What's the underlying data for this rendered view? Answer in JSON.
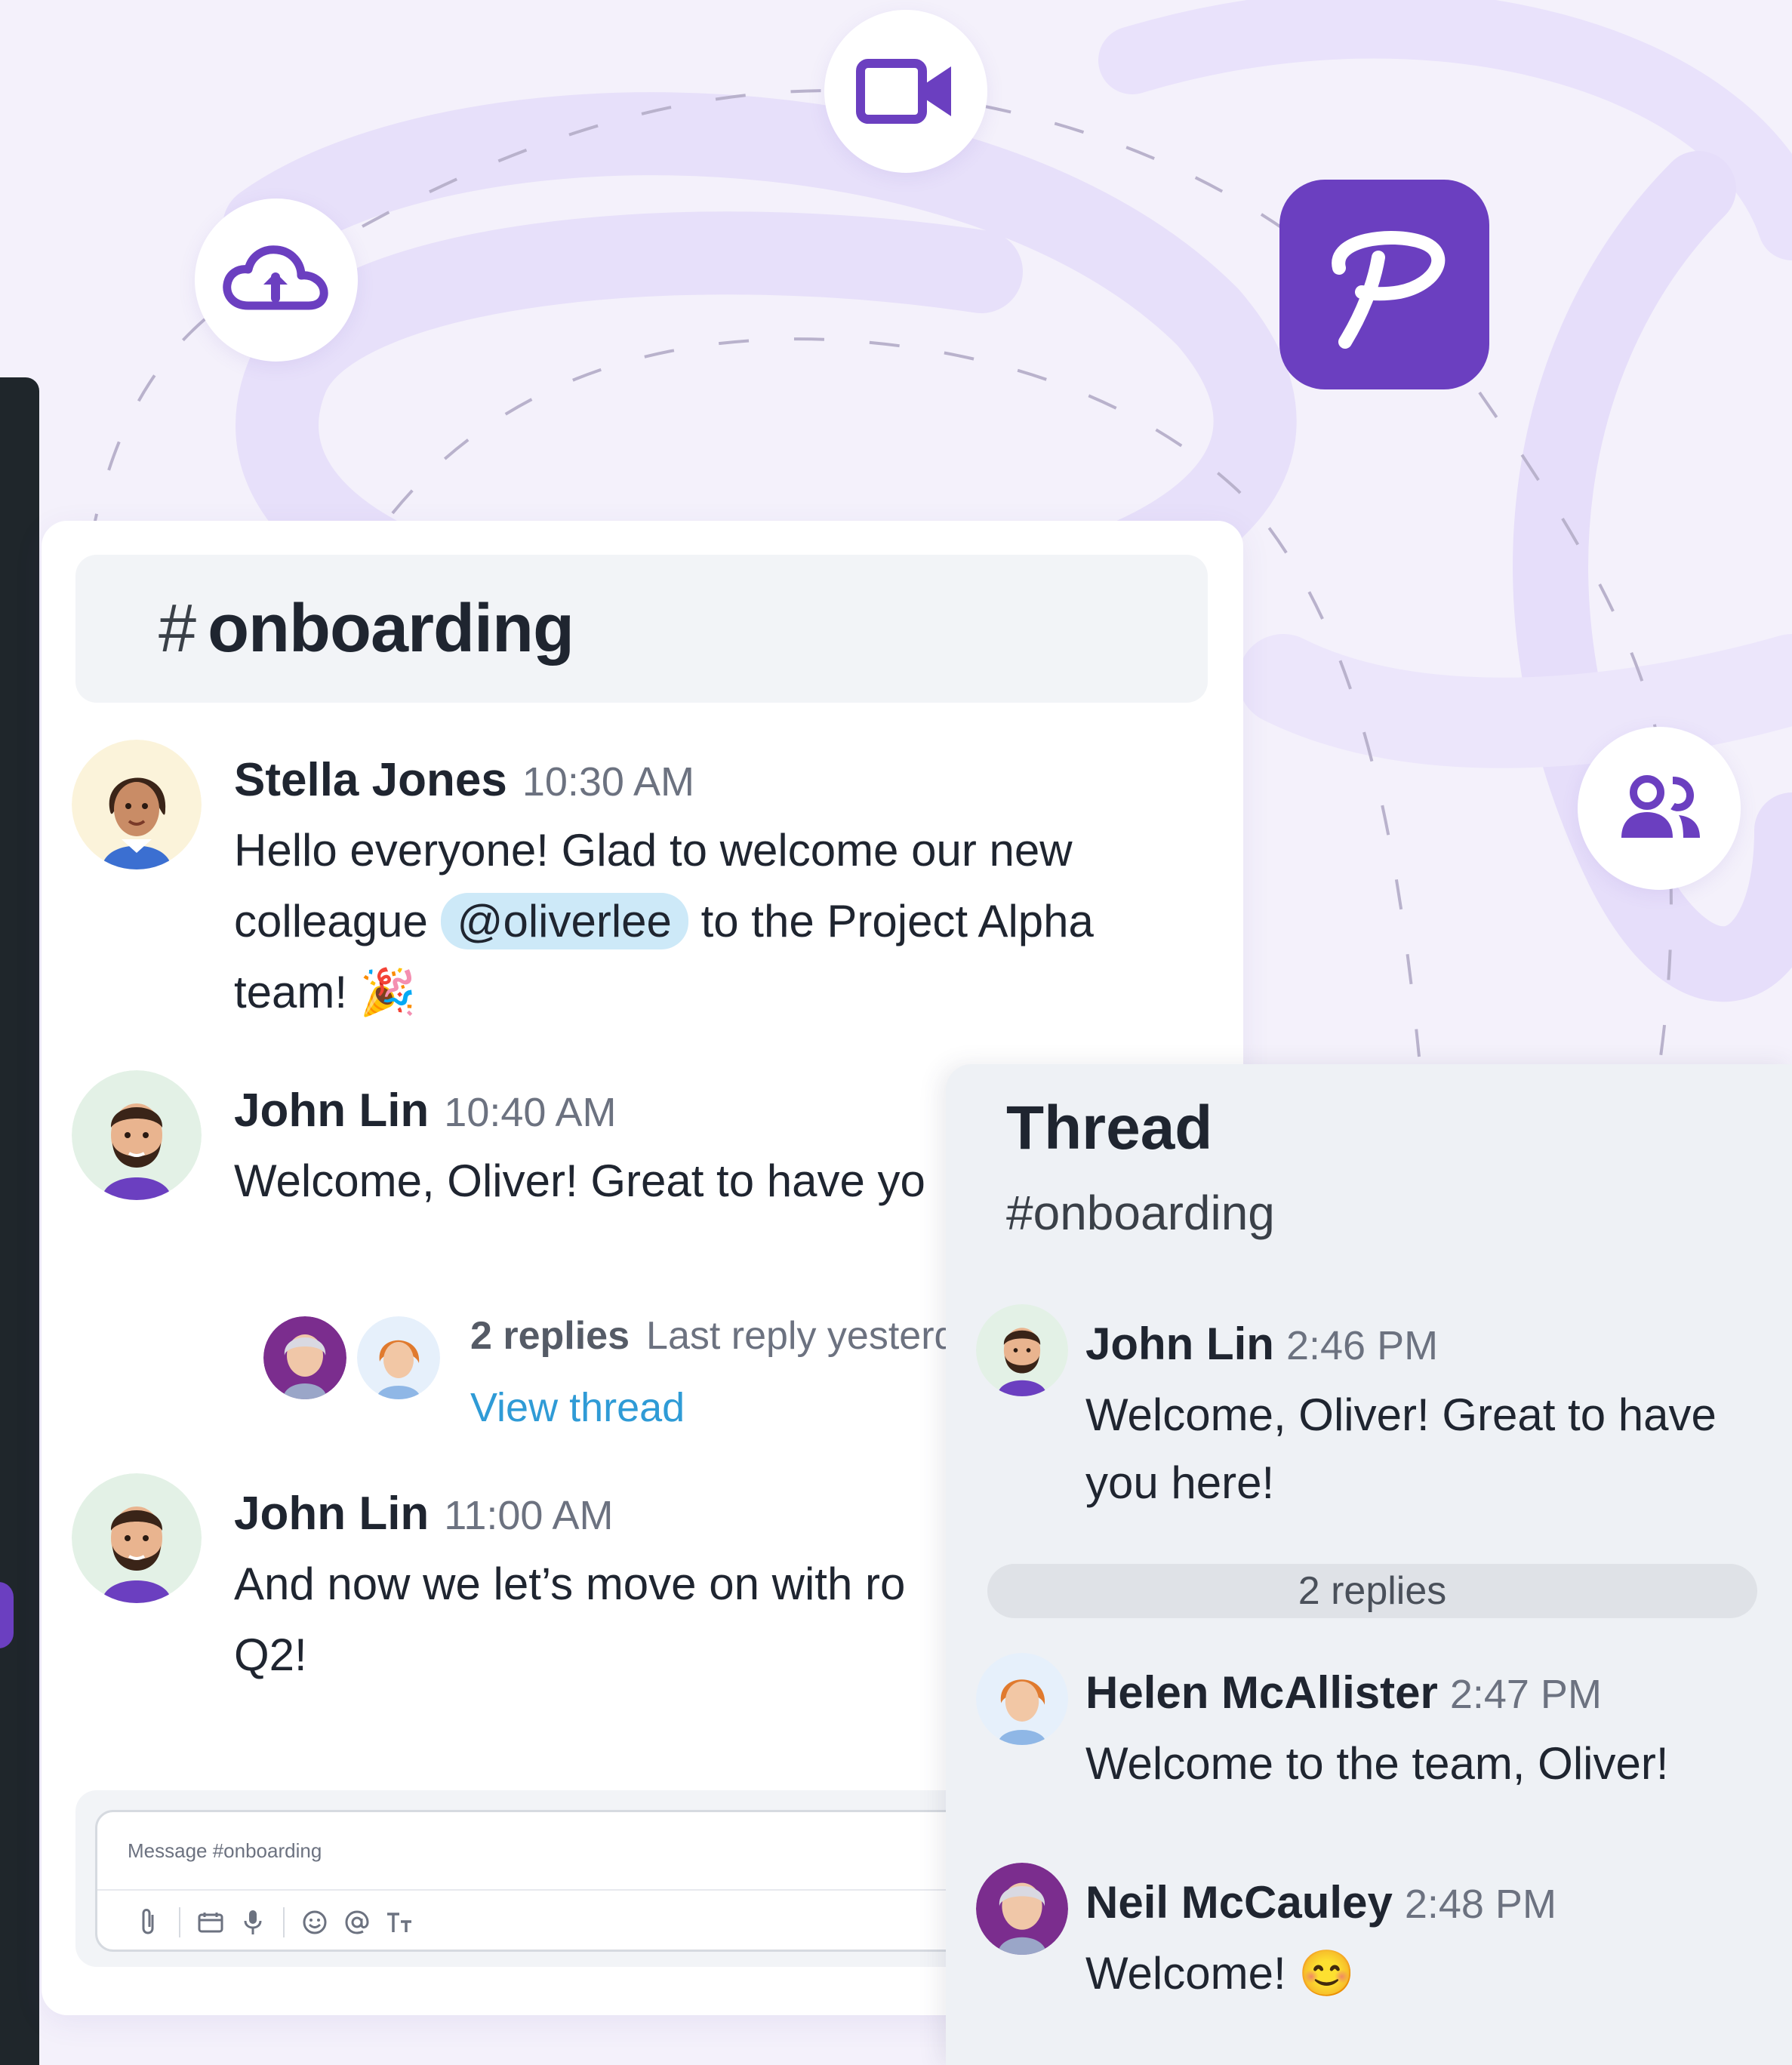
{
  "channel": {
    "hash": "#",
    "name": "onboarding"
  },
  "messages": [
    {
      "author": "Stella Jones",
      "time": "10:30 AM",
      "text_before": "Hello everyone! Glad to welcome our new colleague ",
      "mention": "@oliverlee",
      "text_after": " to the Project Alpha team! 🎉"
    },
    {
      "author": "John Lin",
      "time": "10:40 AM",
      "text": "Welcome, Oliver! Great to have yo"
    },
    {
      "author": "John Lin",
      "time": "11:00 AM",
      "text": "And now we let’s move on with ro Q2!"
    }
  ],
  "thread_summary": {
    "replies": "2 replies",
    "last_reply": "Last reply yesterd",
    "view_thread": "View thread"
  },
  "composer": {
    "placeholder": "Message #onboarding",
    "tools": [
      "paperclip-icon",
      "calendar-icon",
      "microphone-icon",
      "emoji-icon",
      "mention-icon",
      "text-format-icon"
    ]
  },
  "thread": {
    "title": "Thread",
    "channel": "#onboarding",
    "root": {
      "author": "John Lin",
      "time": "2:46 PM",
      "text": "Welcome, Oliver! Great to have you here!"
    },
    "replies_label": "2 replies",
    "replies": [
      {
        "author": "Helen McAllister",
        "time": "2:47 PM",
        "text": "Welcome to the team, Oliver!"
      },
      {
        "author": "Neil McCauley",
        "time": "2:48 PM",
        "text": "Welcome! 😊"
      }
    ]
  },
  "floating_icons": [
    "cloud-upload-icon",
    "video-camera-icon",
    "app-logo",
    "users-icon"
  ],
  "colors": {
    "brand": "#6b3fc0",
    "link": "#2f9bd6",
    "mention_bg": "#cde9f8",
    "background": "#f4f1fb"
  }
}
